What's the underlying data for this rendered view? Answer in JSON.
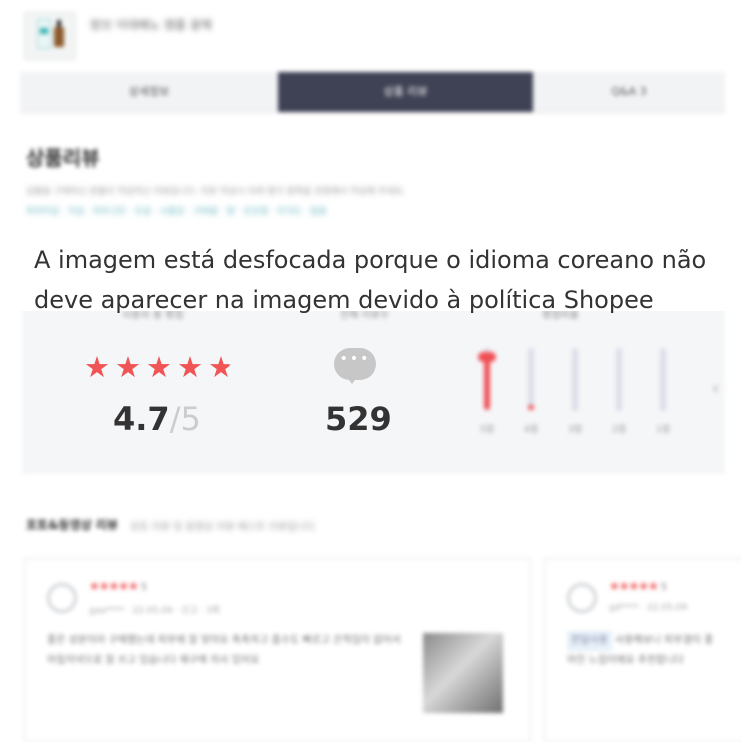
{
  "product": {
    "title": "랑브 이데베노 앰플 광채"
  },
  "tabs": [
    {
      "label": "상세정보",
      "active": false
    },
    {
      "label": "상품 리뷰",
      "active": true
    },
    {
      "label": "Q&A 3",
      "active": false
    }
  ],
  "reviews_section": {
    "title": "상품리뷰",
    "notice_line1": "상품을 구매하신 분들이 작성하신 리뷰입니다. 리뷰 작성시 아래 평가 항목을 포함해서 작성해 주세요.",
    "notice_line2": "피부타입 · 지성 · 피부고민 · 모공 · 사용감 · 가벼움 · 향 · 은은함 · 자극도 · 없음"
  },
  "overlay": {
    "line1": "A imagem está desfocada porque o idioma coreano não",
    "line2": "deve aparecer na imagem devido à política Shopee"
  },
  "stats": {
    "rating_label": "사용자 총 평점",
    "rating": "4.7",
    "rating_total": "/5",
    "rating_value": 4.7,
    "count_label": "전체 리뷰수",
    "review_count": "529",
    "dist_label": "평점비율",
    "distribution": [
      {
        "label": "5점",
        "fraction": 0.88
      },
      {
        "label": "4점",
        "fraction": 0.08
      },
      {
        "label": "3점",
        "fraction": 0.02
      },
      {
        "label": "2점",
        "fraction": 0.01
      },
      {
        "label": "1점",
        "fraction": 0.01
      }
    ]
  },
  "photo_reviews": {
    "title": "포토&동영상 리뷰",
    "subtitle": "포토 리뷰 및 동영상 리뷰 베스트 리뷰입니다",
    "cards": [
      {
        "score": "5",
        "meta": "gaa**** · 22.05.09 · 신고 · 3회",
        "body": "좋은 성분이라 구매했는데 피부에 잘 맞아요 촉촉하고 흡수도 빠르고 끈적임이 없어서 아침저녁으로 잘 쓰고 있습니다 재구매 의사 있어요"
      },
      {
        "score": "5",
        "meta": "gd**** · 22.05.09",
        "badge": "한달사용",
        "body": "사용해보니 피부결이 좋아진 느낌이에요 추천합니다"
      }
    ]
  },
  "colors": {
    "accent": "#ef4e53",
    "active_tab": "#3f4254",
    "highlight": "#6ab7c3"
  }
}
